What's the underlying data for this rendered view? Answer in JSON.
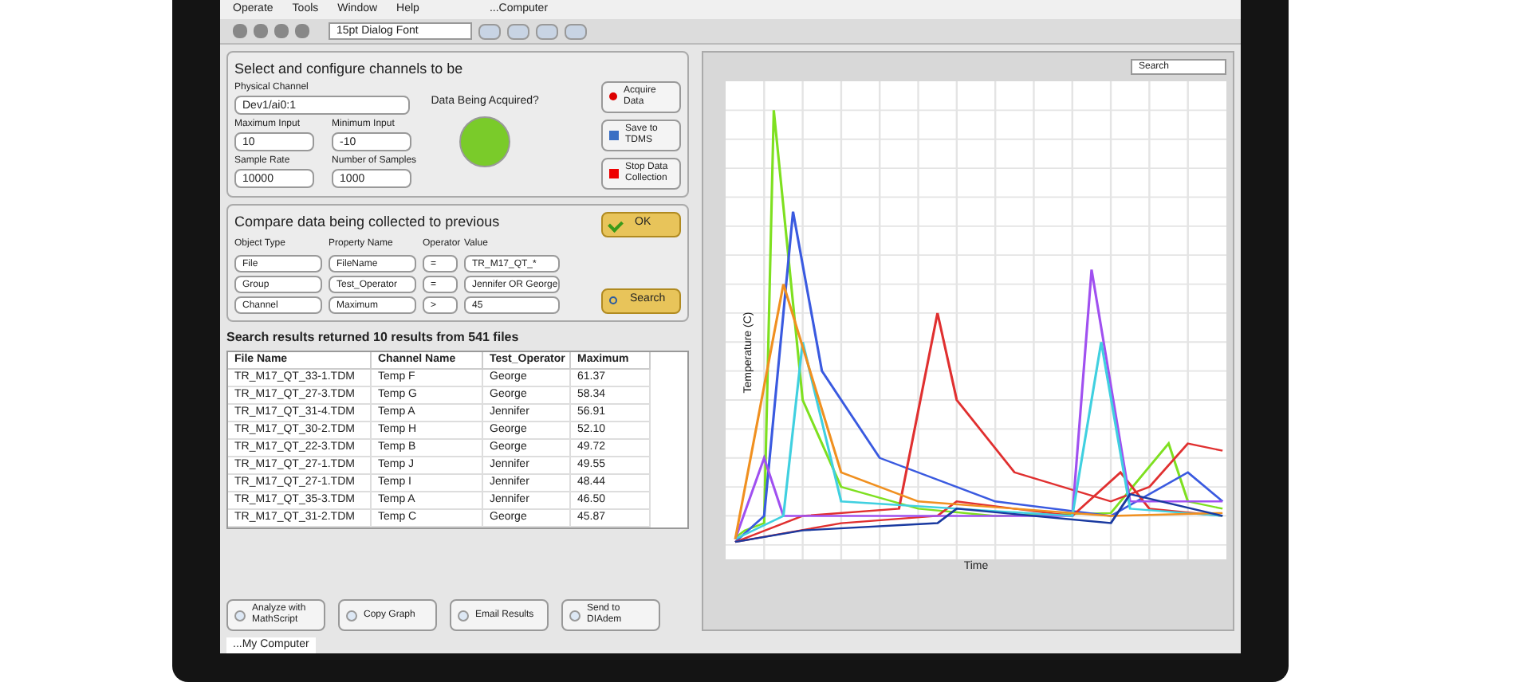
{
  "menu": [
    "Operate",
    "Tools",
    "Window",
    "Help"
  ],
  "window": {
    "title": "...Computer"
  },
  "status_bar": {
    "text": "...My Computer"
  },
  "toolbar": {
    "font": "15pt Dialog Font"
  },
  "configure": {
    "title": "Select and configure channels to be",
    "physical_channel": {
      "label": "Physical Channel",
      "value": "Dev1/ai0:1"
    },
    "fields": [
      {
        "label": "Maximum Input",
        "value": "10"
      },
      {
        "label": "Minimum Input",
        "value": "-10"
      },
      {
        "label": "Sample Rate",
        "value": "10000"
      },
      {
        "label": "Number of Samples",
        "value": "1000"
      }
    ],
    "indicator": {
      "label": "Data Being Acquired?",
      "on": true
    },
    "buttons": [
      {
        "label": "Acquire Data",
        "kind": "record"
      },
      {
        "label": "Save to TDMS",
        "kind": "save"
      },
      {
        "label": "Stop Data Collection",
        "kind": "stop"
      }
    ]
  },
  "compare": {
    "title": "Compare data being collected to previous",
    "ok": "OK",
    "search": "Search",
    "columns": [
      "Object Type",
      "Property Name",
      "Operator",
      "Value"
    ],
    "rows": [
      [
        "File",
        "FileName",
        "=",
        "TR_M17_QT_*"
      ],
      [
        "Group",
        "Test_Operator",
        "=",
        "Jennifer OR George"
      ],
      [
        "Channel",
        "Maximum",
        ">",
        "45"
      ]
    ]
  },
  "results": {
    "title": "Search results returned 10 results from 541 files",
    "columns": [
      "File Name",
      "Channel Name",
      "Test_Operator",
      "Maximum"
    ],
    "rows": [
      [
        "TR_M17_QT_33-1.TDM",
        "Temp F",
        "George",
        "61.37"
      ],
      [
        "TR_M17_QT_27-3.TDM",
        "Temp G",
        "George",
        "58.34"
      ],
      [
        "TR_M17_QT_31-4.TDM",
        "Temp A",
        "Jennifer",
        "56.91"
      ],
      [
        "TR_M17_QT_30-2.TDM",
        "Temp H",
        "George",
        "52.10"
      ],
      [
        "TR_M17_QT_22-3.TDM",
        "Temp B",
        "George",
        "49.72"
      ],
      [
        "TR_M17_QT_27-1.TDM",
        "Temp J",
        "Jennifer",
        "49.55"
      ],
      [
        "TR_M17_QT_27-1.TDM",
        "Temp I",
        "Jennifer",
        "48.44"
      ],
      [
        "TR_M17_QT_35-3.TDM",
        "Temp A",
        "Jennifer",
        "46.50"
      ],
      [
        "TR_M17_QT_31-2.TDM",
        "Temp C",
        "George",
        "45.87"
      ]
    ]
  },
  "bottom_buttons": [
    "Analyze with MathScript",
    "Copy Graph",
    "Email Results",
    "Send to DIAdem"
  ],
  "graph": {
    "search": "Search",
    "xlabel": "Time",
    "ylabel": "Temperature (C)"
  }
}
